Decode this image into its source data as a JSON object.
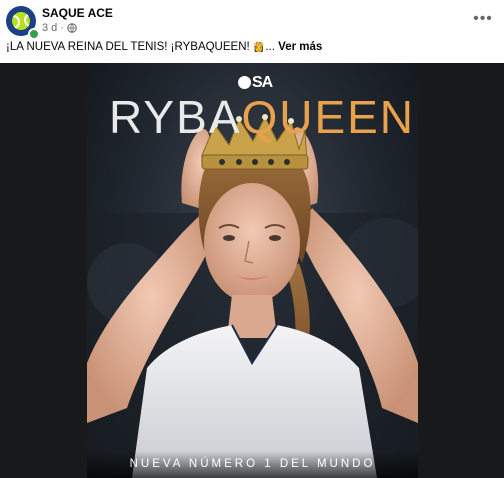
{
  "post": {
    "page_name": "SAQUE ACE",
    "time": "3 d",
    "separator": "·",
    "more_icon": "more-horizontal-icon",
    "caption_text": "¡LA NUEVA REINA DEL TENIS! ¡RYBAQUEEN! ",
    "caption_emoji": "👸",
    "ellipsis": "...",
    "see_more": "Ver más"
  },
  "poster": {
    "brand": "SA",
    "headline_part1": "RYBA",
    "headline_part2": "QUEEN",
    "subtitle": "NUEVA NÚMERO 1 DEL MUNDO",
    "headline_accent": "#e8a24b"
  },
  "colors": {
    "avatar_bg": "#1d3f86",
    "avatar_ball": "#b7e11c",
    "online": "#31a24c"
  }
}
